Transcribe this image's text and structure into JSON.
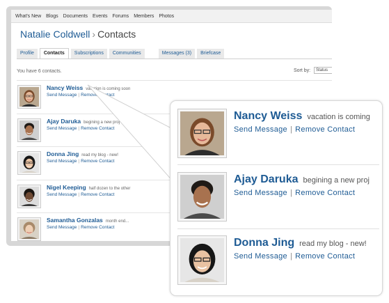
{
  "topnav": [
    "What's New",
    "Blogs",
    "Documents",
    "Events",
    "Forums",
    "Members",
    "Photos"
  ],
  "header": {
    "owner": "Natalie Coldwell",
    "separator": "›",
    "section": "Contacts"
  },
  "tabs": [
    {
      "label": "Profile",
      "active": false
    },
    {
      "label": "Contacts",
      "active": true
    },
    {
      "label": "Subscriptions",
      "active": false
    },
    {
      "label": "Communities",
      "active": false
    },
    {
      "label": "Messages (3)",
      "active": false
    },
    {
      "label": "Briefcase",
      "active": false
    }
  ],
  "summary": {
    "count_text": "You have 6 contacts.",
    "sort_label": "Sort by:",
    "sort_value": "Status"
  },
  "actions": {
    "send": "Send Message",
    "separator": "|",
    "remove": "Remove Contact"
  },
  "contacts": [
    {
      "name": "Nancy Weiss",
      "status": "vacation is coming soon"
    },
    {
      "name": "Ajay Daruka",
      "status": "begining a new proj"
    },
    {
      "name": "Donna Jing",
      "status": "read my blog - new!"
    },
    {
      "name": "Nigel Keeping",
      "status": "half dozen to the other"
    },
    {
      "name": "Samantha Gonzalas",
      "status": "month end..."
    }
  ],
  "zoom": [
    {
      "name": "Nancy Weiss",
      "status": "vacation is coming"
    },
    {
      "name": "Ajay Daruka",
      "status": "begining a new proj"
    },
    {
      "name": "Donna Jing",
      "status": "read my blog - new!"
    }
  ],
  "colors": {
    "link": "#1e5b94",
    "frame": "#d7d7d7",
    "nav_bg": "#f1f1f1"
  }
}
